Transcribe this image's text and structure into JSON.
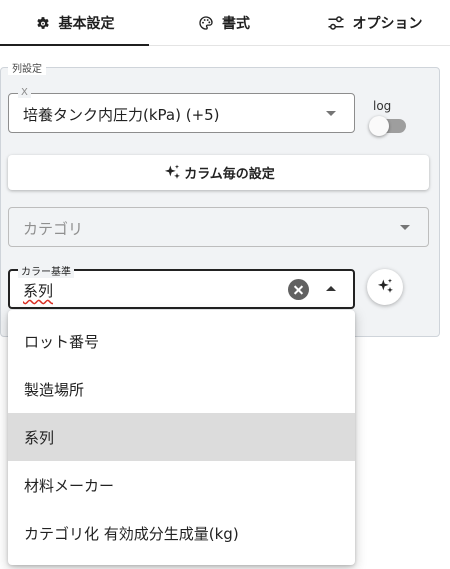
{
  "tabs": [
    {
      "label": "基本設定",
      "icon": "gear-icon",
      "active": true
    },
    {
      "label": "書式",
      "icon": "palette-icon",
      "active": false
    },
    {
      "label": "オプション",
      "icon": "sliders-icon",
      "active": false
    }
  ],
  "section": {
    "legend": "列設定"
  },
  "x_field": {
    "label": "X",
    "value": "培養タンク内圧力(kPa) (+5)"
  },
  "log_toggle": {
    "label": "log",
    "on": false
  },
  "column_button": {
    "label": "カラム毎の設定",
    "icon": "sparkle-icon"
  },
  "category_field": {
    "placeholder": "カテゴリ"
  },
  "color_field": {
    "label": "カラー基準",
    "value": "系列"
  },
  "dropdown": {
    "options": [
      "ロット番号",
      "製造場所",
      "系列",
      "材料メーカー",
      "カテゴリ化 有効成分生成量(kg)"
    ],
    "selected_index": 2
  },
  "colors": {
    "accent": "#1f1f1f",
    "selected_bg": "#dcdcdc",
    "panel_bg": "#f1f3f5",
    "spellcheck": "#d93025"
  }
}
